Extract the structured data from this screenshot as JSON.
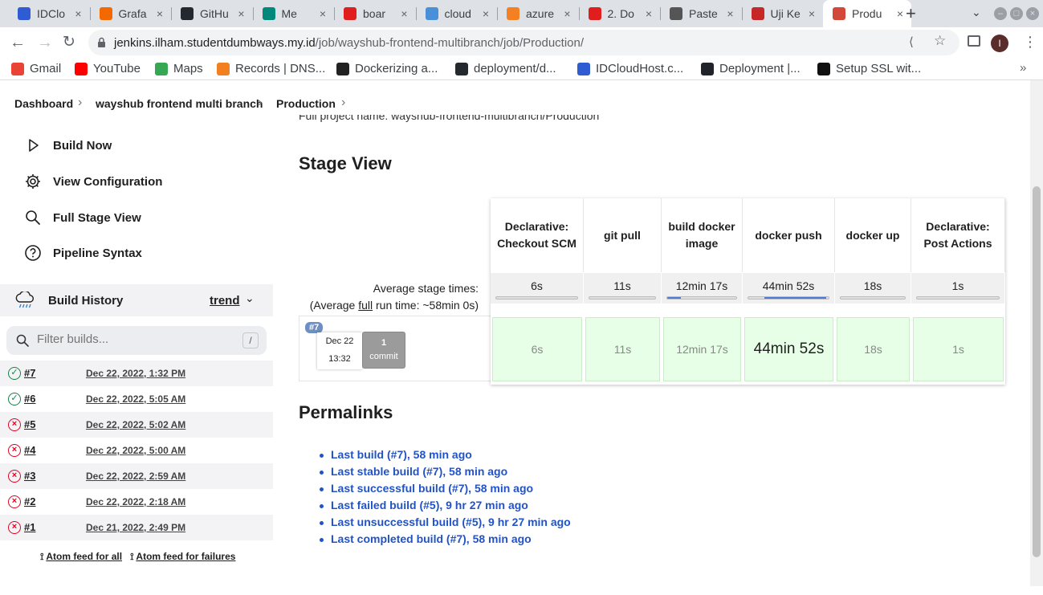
{
  "browser": {
    "tabs": [
      {
        "title": "IDClo",
        "icon": "idcloudhost-icon",
        "color": "#2f5bd3"
      },
      {
        "title": "Grafa",
        "icon": "grafana-icon",
        "color": "#f46800"
      },
      {
        "title": "GitHu",
        "icon": "github-icon",
        "color": "#24292f"
      },
      {
        "title": "Me",
        "icon": "google-meet-icon",
        "color": "#00897b"
      },
      {
        "title": "boar",
        "icon": "board-icon",
        "color": "#e01e1e"
      },
      {
        "title": "cloud",
        "icon": "cloud-icon",
        "color": "#4a90d9"
      },
      {
        "title": "azure",
        "icon": "stackoverflow-icon",
        "color": "#f48024"
      },
      {
        "title": "2. Do",
        "icon": "doc-icon",
        "color": "#e01e1e"
      },
      {
        "title": "Paste",
        "icon": "paste-icon",
        "color": "#555555"
      },
      {
        "title": "Uji Ke",
        "icon": "speedtest-icon",
        "color": "#c62828"
      },
      {
        "title": "Produ",
        "icon": "jenkins-icon",
        "color": "#d24939",
        "active": true
      }
    ],
    "url_host": "jenkins.ilham.studentdumbways.my.id",
    "url_path": "/job/wayshub-frontend-multibranch/job/Production/",
    "avatar_letter": "I",
    "bookmarks": [
      {
        "label": "Gmail",
        "icon": "gmail-icon",
        "color": "#ea4335"
      },
      {
        "label": "YouTube",
        "icon": "youtube-icon",
        "color": "#ff0000"
      },
      {
        "label": "Maps",
        "icon": "maps-icon",
        "color": "#34a853"
      },
      {
        "label": "Records | DNS...",
        "icon": "cloudflare-icon",
        "color": "#f38020"
      },
      {
        "label": "Dockerizing a...",
        "icon": "circle-icon",
        "color": "#222222"
      },
      {
        "label": "deployment/d...",
        "icon": "github-icon",
        "color": "#24292f"
      },
      {
        "label": "IDCloudHost.c...",
        "icon": "idcloudhost-icon",
        "color": "#2f5bd3"
      },
      {
        "label": "Deployment |...",
        "icon": "react-icon",
        "color": "#20232a"
      },
      {
        "label": "Setup SSL wit...",
        "icon": "tower-icon",
        "color": "#111111"
      }
    ]
  },
  "breadcrumb": [
    "Dashboard",
    "wayshub frontend multi branch",
    "Production"
  ],
  "sidebar": {
    "tasks": [
      "Build Now",
      "View Configuration",
      "Full Stage View",
      "Pipeline Syntax"
    ],
    "build_history": {
      "title": "Build History",
      "trend_label": "trend",
      "filter_placeholder": "Filter builds...",
      "shortcut": "/",
      "builds": [
        {
          "num": "#7",
          "date": "Dec 22, 2022, 1:32 PM",
          "status": "success"
        },
        {
          "num": "#6",
          "date": "Dec 22, 2022, 5:05 AM",
          "status": "success"
        },
        {
          "num": "#5",
          "date": "Dec 22, 2022, 5:02 AM",
          "status": "failed"
        },
        {
          "num": "#4",
          "date": "Dec 22, 2022, 5:00 AM",
          "status": "failed"
        },
        {
          "num": "#3",
          "date": "Dec 22, 2022, 2:59 AM",
          "status": "failed"
        },
        {
          "num": "#2",
          "date": "Dec 22, 2022, 2:18 AM",
          "status": "failed"
        },
        {
          "num": "#1",
          "date": "Dec 21, 2022, 2:49 PM",
          "status": "failed"
        }
      ],
      "feed_all": "Atom feed for all",
      "feed_failures": "Atom feed for failures"
    }
  },
  "main": {
    "full_project_name": "Full project name: wayshub-frontend-multibranch/Production",
    "stage_view_title": "Stage View",
    "avg_label_1": "Average stage times:",
    "avg_label_2_pre": "(Average ",
    "avg_label_2_link": "full",
    "avg_label_2_post": " run time: ~58min 0s)",
    "stages": [
      {
        "name": "Declarative: Checkout SCM",
        "avg": "6s",
        "avg_fraction": 0.0,
        "run": "6s"
      },
      {
        "name": "git pull",
        "avg": "11s",
        "avg_fraction": 0.0,
        "run": "11s"
      },
      {
        "name": "build docker image",
        "avg": "12min 17s",
        "avg_fraction": 0.2,
        "run": "12min 17s"
      },
      {
        "name": "docker push",
        "avg": "44min 52s",
        "avg_fraction": 0.77,
        "run": "44min 52s"
      },
      {
        "name": "docker up",
        "avg": "18s",
        "avg_fraction": 0.0,
        "run": "18s"
      },
      {
        "name": "Declarative: Post Actions",
        "avg": "1s",
        "avg_fraction": 0.0,
        "run": "1s"
      }
    ],
    "run": {
      "badge": "#7",
      "date": "Dec 22",
      "time": "13:32",
      "commits": "1",
      "commit_label": "commit"
    },
    "permalinks_title": "Permalinks",
    "permalinks": [
      "Last build (#7), 58 min ago",
      "Last stable build (#7), 58 min ago",
      "Last successful build (#7), 58 min ago",
      "Last failed build (#5), 9 hr 27 min ago",
      "Last unsuccessful build (#5), 9 hr 27 min ago",
      "Last completed build (#7), 58 min ago"
    ]
  }
}
